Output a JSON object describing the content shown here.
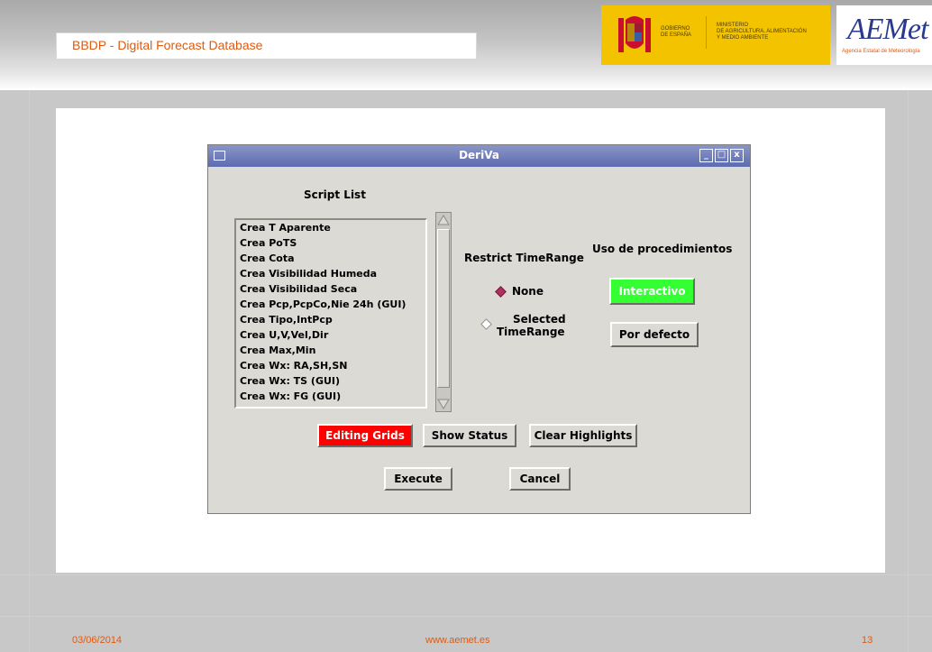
{
  "slide": {
    "title": "BBDP - Digital Forecast Database",
    "gov_text": "GOBIERNO\nDE ESPAÑA",
    "ministry_text": "MINISTERIO\nDE AGRICULTURA, ALIMENTACIÓN\nY MEDIO AMBIENTE",
    "aemet_logo": "AEMet",
    "aemet_subtitle": "Agencia Estatal de Meteorología",
    "footer_date": "03/06/2014",
    "footer_url": "www.aemet.es",
    "footer_page": "13"
  },
  "window": {
    "title": "DeriVa",
    "controls": [
      "_",
      "□",
      "x"
    ]
  },
  "script_list": {
    "heading": "Script List",
    "items": [
      "Crea T Aparente",
      "Crea PoTS",
      "Crea Cota",
      "Crea Visibilidad Humeda",
      "Crea Visibilidad Seca",
      "Crea Pcp,PcpCo,Nie 24h (GUI)",
      "Crea Tipo,IntPcp",
      "Crea U,V,Vel,Dir",
      "Crea Max,Min",
      "Crea Wx: RA,SH,SN",
      "Crea Wx: TS (GUI)",
      "Crea Wx: FG (GUI)"
    ]
  },
  "restrict": {
    "heading": "Restrict TimeRange",
    "option_none": "None",
    "option_selected_1": "Selected",
    "option_selected_2": "TimeRange"
  },
  "procedures": {
    "heading": "Uso de procedimientos",
    "interactive": "Interactivo",
    "default": "Por defecto"
  },
  "buttons": {
    "editing_grids": "Editing Grids",
    "show_status": "Show Status",
    "clear_highlights": "Clear Highlights",
    "execute": "Execute",
    "cancel": "Cancel"
  },
  "colors": {
    "accent_orange": "#e05a10",
    "title_bar": "#5d6bb0",
    "editing_grids_bg": "#ff0000",
    "interactivo_bg": "#33ff33",
    "radio_selected": "#b03060"
  }
}
